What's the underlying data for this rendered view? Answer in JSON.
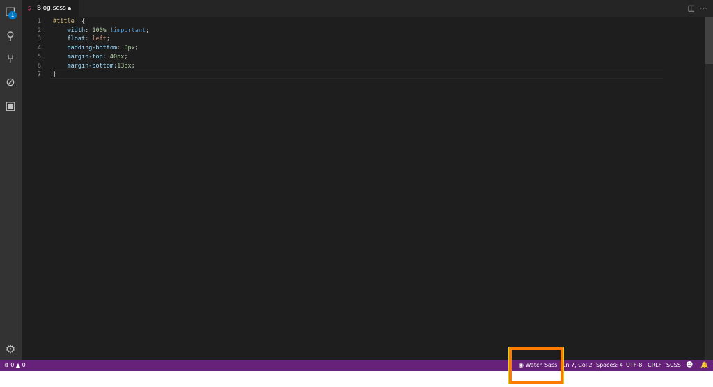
{
  "activity_bar": {
    "explorer_badge": "1",
    "items": [
      "explorer",
      "search",
      "source-control",
      "debug",
      "extensions"
    ]
  },
  "tab": {
    "filename": "Blog.scss",
    "dirty": true
  },
  "editor": {
    "lines": [
      {
        "n": "1",
        "parts": [
          [
            "sel",
            "#title"
          ],
          [
            "",
            "  {"
          ]
        ]
      },
      {
        "n": "2",
        "parts": [
          [
            "",
            "    "
          ],
          [
            "prop",
            "width"
          ],
          [
            "",
            ": "
          ],
          [
            "num",
            "100%"
          ],
          [
            "",
            ""
          ],
          [
            "kw",
            " !important"
          ],
          [
            "",
            ";"
          ]
        ]
      },
      {
        "n": "3",
        "parts": [
          [
            "",
            "    "
          ],
          [
            "prop",
            "float"
          ],
          [
            "",
            ": "
          ],
          [
            "val",
            "left"
          ],
          [
            "",
            ";"
          ]
        ]
      },
      {
        "n": "4",
        "parts": [
          [
            "",
            "    "
          ],
          [
            "prop",
            "padding-bottom"
          ],
          [
            "",
            ": "
          ],
          [
            "num",
            "0px"
          ],
          [
            "",
            ";"
          ]
        ]
      },
      {
        "n": "5",
        "parts": [
          [
            "",
            "    "
          ],
          [
            "prop",
            "margin-top"
          ],
          [
            "",
            ": "
          ],
          [
            "num",
            "40px"
          ],
          [
            "",
            ";"
          ]
        ]
      },
      {
        "n": "6",
        "parts": [
          [
            "",
            "    "
          ],
          [
            "prop",
            "margin-bottom"
          ],
          [
            "",
            ":"
          ],
          [
            "num",
            "13px"
          ],
          [
            "",
            ";"
          ]
        ]
      },
      {
        "n": "7",
        "parts": [
          [
            "",
            "}"
          ]
        ]
      }
    ]
  },
  "status": {
    "errors": "0",
    "warnings": "0",
    "watch_sass": "Watch Sass",
    "position": "Ln 7, Col 2",
    "spaces": "Spaces: 4",
    "encoding": "UTF-8",
    "eol": "CRLF",
    "language": "SCSS"
  },
  "colors": {
    "status_bar": "#68217a",
    "highlight": "#ff7b00"
  }
}
